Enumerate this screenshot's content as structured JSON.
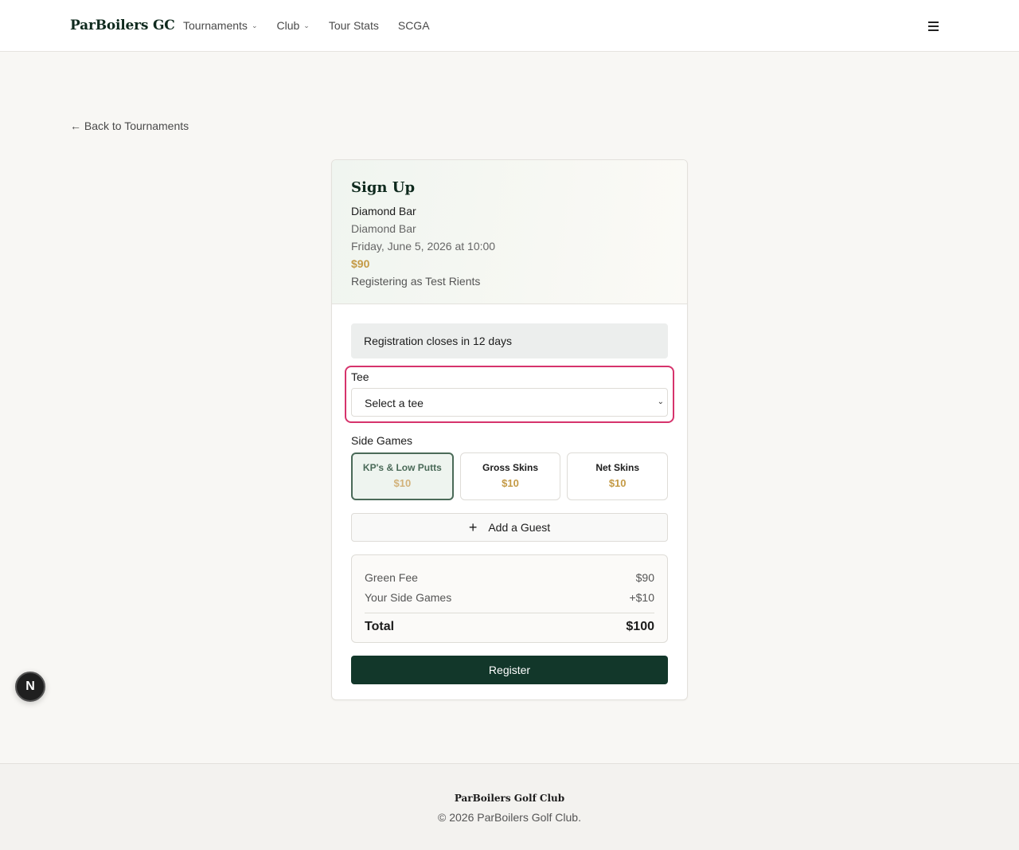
{
  "header": {
    "brand": "ParBoilers GC",
    "nav": [
      {
        "label": "Tournaments"
      },
      {
        "label": "Club"
      },
      {
        "label": "Tour Stats"
      },
      {
        "label": "SCGA"
      }
    ]
  },
  "back_link": "← Back to Tournaments",
  "card": {
    "title": "Sign Up",
    "course_name": "Diamond Bar",
    "location": "Diamond Bar",
    "datetime": "Friday, June 5, 2026 at 10:00",
    "price": "$90",
    "registering_as": "Registering as Test Rients",
    "notice": "Registration closes in 12 days",
    "tee": {
      "label": "Tee",
      "selected": "Select a tee"
    },
    "side_games": {
      "label": "Side Games",
      "items": [
        {
          "name": "KP's & Low Putts",
          "price": "$10",
          "selected": true
        },
        {
          "name": "Gross Skins",
          "price": "$10",
          "selected": false
        },
        {
          "name": "Net Skins",
          "price": "$10",
          "selected": false
        }
      ]
    },
    "add_guest_label": "Add a Guest",
    "summary": {
      "green_fee_label": "Green Fee",
      "green_fee_value": "$90",
      "side_games_label": "Your Side Games",
      "side_games_value": "+$10",
      "total_label": "Total",
      "total_value": "$100"
    },
    "register_label": "Register"
  },
  "badge": "N",
  "footer": {
    "name": "ParBoilers Golf Club",
    "copyright": "© 2026 ParBoilers Golf Club."
  },
  "colors": {
    "accent_dark_green": "#12372a",
    "price_gold": "#c49a45",
    "focus_ring": "#d6336c"
  },
  "icons": {
    "nav_dropdown": "chevron-down-icon",
    "menu": "hamburger-menu-icon",
    "back": "arrow-left-icon",
    "select": "chevron-down-icon",
    "add": "plus-icon"
  }
}
